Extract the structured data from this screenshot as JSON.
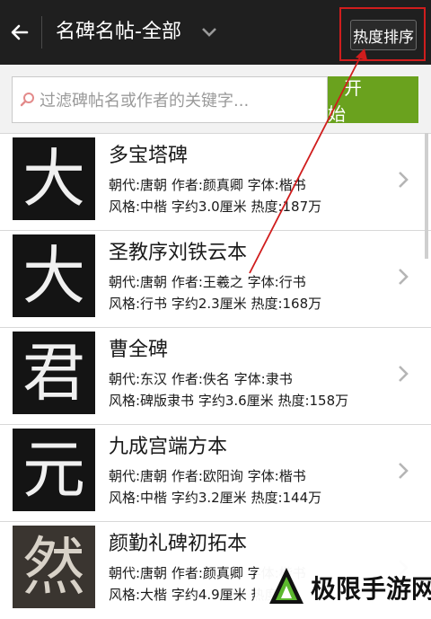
{
  "header": {
    "title": "名碑名帖-全部",
    "sort_label": "热度排序"
  },
  "search": {
    "placeholder": "过滤碑帖名或作者的关键字...",
    "button_label": "开 始"
  },
  "items": [
    {
      "name": "多宝塔碑",
      "thumb_char": "大",
      "meta1": "朝代:唐朝  作者:颜真卿  字体:楷书",
      "meta2": "风格:中楷  字约3.0厘米  热度:187万"
    },
    {
      "name": "圣教序刘铁云本",
      "thumb_char": "大",
      "meta1": "朝代:唐朝  作者:王羲之  字体:行书",
      "meta2": "风格:行书  字约2.3厘米  热度:168万"
    },
    {
      "name": "曹全碑",
      "thumb_char": "君",
      "meta1": "朝代:东汉  作者:佚名  字体:隶书",
      "meta2": "风格:碑版隶书  字约3.6厘米  热度:158万"
    },
    {
      "name": "九成宫端方本",
      "thumb_char": "元",
      "meta1": "朝代:唐朝  作者:欧阳询  字体:楷书",
      "meta2": "风格:中楷  字约3.2厘米  热度:144万"
    },
    {
      "name": "颜勤礼碑初拓本",
      "thumb_char": "然",
      "meta1": "朝代:唐朝  作者:颜真卿  字体:楷书",
      "meta2": "风格:大楷  字约4.9厘米  热度:"
    }
  ],
  "watermark": {
    "text": "极限手游网"
  },
  "colors": {
    "header_bg": "#1f1f1f",
    "accent_green": "#6aa21e",
    "annotation_red": "#d01d1d"
  }
}
